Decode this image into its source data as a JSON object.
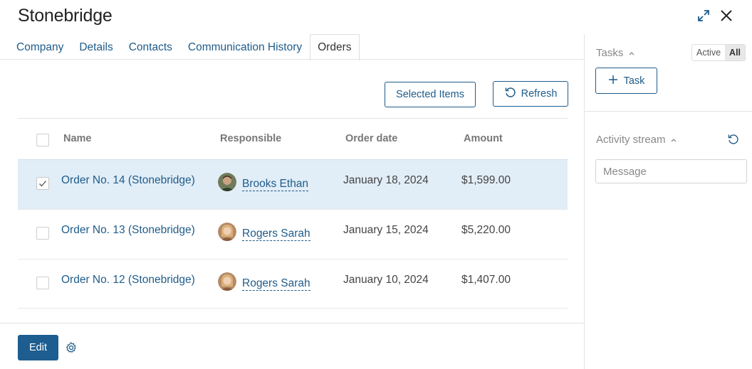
{
  "header": {
    "title": "Stonebridge",
    "expand_icon": "expand-arrows-icon",
    "close_icon": "close-icon"
  },
  "tabs": [
    {
      "label": "Company",
      "active": false
    },
    {
      "label": "Details",
      "active": false
    },
    {
      "label": "Contacts",
      "active": false
    },
    {
      "label": "Communication History",
      "active": false
    },
    {
      "label": "Orders",
      "active": true
    }
  ],
  "toolbar": {
    "selected_items_label": "Selected Items",
    "refresh_label": "Refresh"
  },
  "table": {
    "columns": [
      "Name",
      "Responsible",
      "Order date",
      "Amount"
    ],
    "rows": [
      {
        "name": "Order No. 14 (Stonebridge)",
        "responsible": "Brooks Ethan",
        "date": "January 18, 2024",
        "amount": "$1,599.00",
        "checked": true
      },
      {
        "name": "Order No. 13 (Stonebridge)",
        "responsible": "Rogers Sarah",
        "date": "January 15, 2024",
        "amount": "$5,220.00",
        "checked": false
      },
      {
        "name": "Order No. 12 (Stonebridge)",
        "responsible": "Rogers Sarah",
        "date": "January 10, 2024",
        "amount": "$1,407.00",
        "checked": false
      }
    ]
  },
  "footer": {
    "edit_label": "Edit"
  },
  "sidebar": {
    "tasks_label": "Tasks",
    "filter_active": "Active",
    "filter_all": "All",
    "add_task_label": "Task",
    "activity_label": "Activity stream",
    "message_placeholder": "Message"
  },
  "colors": {
    "accent": "#1f5c8a",
    "selected_row": "#e1edf7",
    "edit_button": "#1d5d8f"
  }
}
